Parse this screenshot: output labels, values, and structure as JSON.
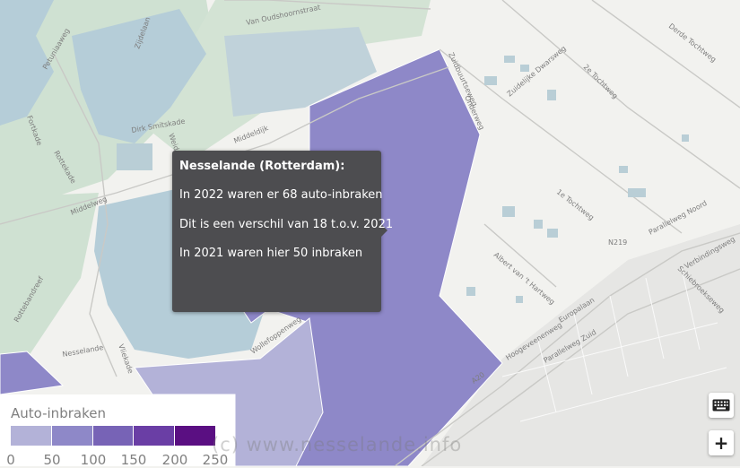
{
  "tooltip": {
    "title": "Nesselande (Rotterdam):",
    "line1": "In 2022 waren er 68 auto-inbraken",
    "line2": "Dit is een verschil van 18 t.o.v. 2021",
    "line3": "In 2021 waren hier 50 inbraken"
  },
  "legend": {
    "title": "Auto-inbraken",
    "ticks": [
      "0",
      "50",
      "100",
      "150",
      "200",
      "250"
    ],
    "colors": [
      "#b3b2d8",
      "#8e88c8",
      "#7763b6",
      "#6a3ea5",
      "#5a0f82"
    ]
  },
  "watermark": "(c) www.nesselande.info",
  "controls": {
    "keyboard_icon": "keyboard-icon",
    "zoom_in_label": "+"
  },
  "streets": [
    "Van Oudshoornstraat",
    "Zuidelijke Dwarsweg",
    "2e Tochtweg",
    "Derde Tochtweg",
    "Dirk Smitskade",
    "Middelweg",
    "Zuidbuurtseweg",
    "Onderweg",
    "1e Tochtweg",
    "Rottekade",
    "Rottebandreef",
    "Nesselande",
    "Wollefoppenweg",
    "Albert van 't Hartweg",
    "Hoogeveenenweg",
    "Europalaan",
    "Parallelweg Noord",
    "Schiebroekseweg",
    "Parallelweg Zuid",
    "Verbindingsweg",
    "A20",
    "N219",
    "Vliekade",
    "Fortkade",
    "Weidelaan",
    "Zijdelaan",
    "Middeldijk",
    "Petuniaaweg"
  ],
  "colors": {
    "nesselande_fill": "#8e88c8",
    "tooltip_bg": "#4d4d50",
    "water": "#b5cdd8",
    "park": "#cfe1d2"
  }
}
